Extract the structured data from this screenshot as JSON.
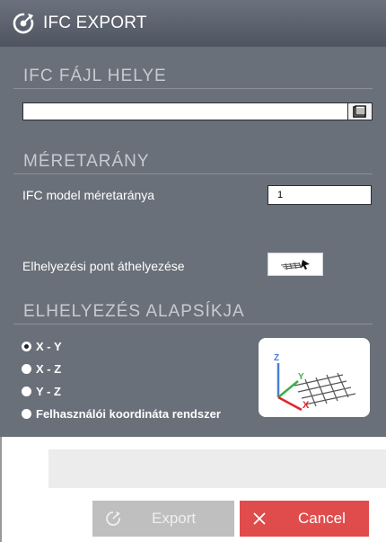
{
  "window": {
    "title": "IFC EXPORT",
    "icon": "export-refresh-icon"
  },
  "sections": {
    "file_location": {
      "title": "IFC FÁJL HELYE",
      "path_value": "",
      "browse_icon": "folder-icon"
    },
    "scale": {
      "title": "MÉRETARÁNY",
      "model_scale_label": "IFC model méretaránya",
      "model_scale_value": "1"
    },
    "placement": {
      "move_label": "Elhelyezési pont áthelyezése",
      "move_icon": "move-grid-icon"
    },
    "base_plane": {
      "title": "ELHELYEZÉS ALAPSÍKJA",
      "options": [
        "X - Y",
        "X - Z",
        "Y - Z",
        "Felhasználói koordináta rendszer"
      ],
      "selected": "X - Y",
      "axes": {
        "z": "Z",
        "y": "Y",
        "x": "X"
      }
    }
  },
  "footer": {
    "export_label": "Export",
    "cancel_label": "Cancel"
  },
  "colors": {
    "panel": "#6a7079",
    "titlebar": "#5a606b",
    "cancel": "#e04c4c",
    "export_disabled": "#bfbfbf",
    "axis_z": "#4a7fd6",
    "axis_y": "#3cb043",
    "axis_x": "#e0242a"
  }
}
